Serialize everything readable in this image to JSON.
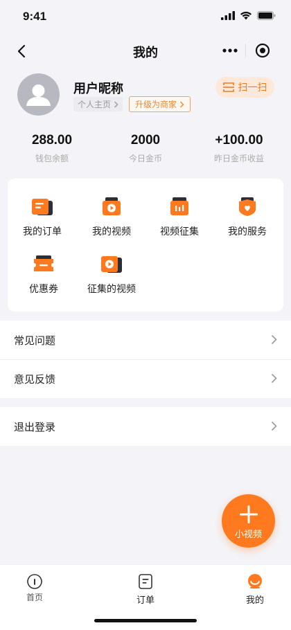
{
  "status": {
    "time": "9:41"
  },
  "nav": {
    "title": "我的"
  },
  "profile": {
    "nickname": "用户昵称",
    "home_tag": "个人主页",
    "upgrade_tag": "升级为商家",
    "scan_label": "扫一扫"
  },
  "stats": [
    {
      "value": "288.00",
      "label": "钱包余额"
    },
    {
      "value": "2000",
      "label": "今日金币"
    },
    {
      "value": "+100.00",
      "label": "昨日金币收益"
    }
  ],
  "grid": {
    "items": [
      {
        "label": "我的订单",
        "icon": "order-icon"
      },
      {
        "label": "我的视频",
        "icon": "video-icon"
      },
      {
        "label": "视频征集",
        "icon": "video-collect-icon"
      },
      {
        "label": "我的服务",
        "icon": "service-icon"
      },
      {
        "label": "优惠券",
        "icon": "coupon-icon"
      },
      {
        "label": "征集的视频",
        "icon": "collected-video-icon"
      }
    ]
  },
  "list": {
    "faq": "常见问题",
    "feedback": "意见反馈",
    "logout": "退出登录"
  },
  "fab": {
    "label": "小视频"
  },
  "tabs": [
    {
      "label": "首页"
    },
    {
      "label": "订单"
    },
    {
      "label": "我的"
    }
  ],
  "colors": {
    "accent": "#ff7a1e",
    "background": "#f4f4f8"
  }
}
